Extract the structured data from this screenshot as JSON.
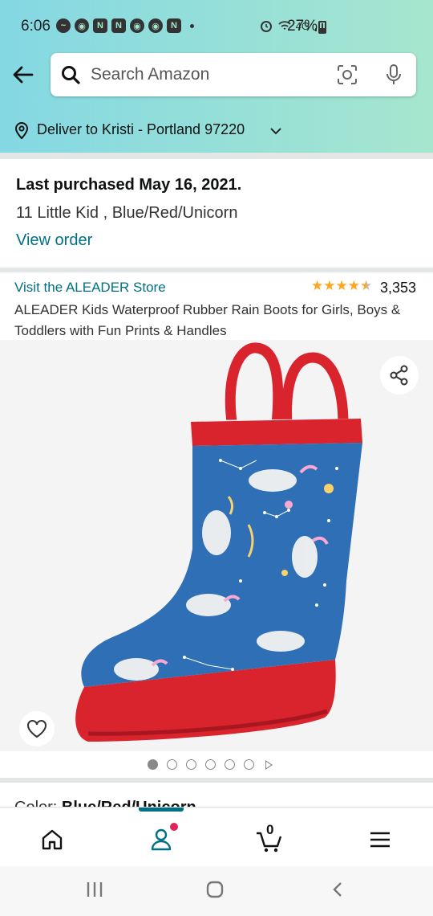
{
  "status_bar": {
    "time": "6:06",
    "network": "4G",
    "battery": "27%"
  },
  "search": {
    "placeholder": "Search Amazon"
  },
  "delivery": {
    "label": "Deliver to Kristi - Portland 97220"
  },
  "purchase_info": {
    "last_purchased": "Last purchased May 16, 2021.",
    "variant": "11 Little Kid , Blue/Red/Unicorn",
    "view_order": "View order"
  },
  "product": {
    "store_link": "Visit the ALEADER Store",
    "rating_stars": 4.5,
    "rating_count": "3,353",
    "title": "ALEADER Kids Waterproof Rubber Rain Boots for Girls, Boys & Toddlers with Fun Prints & Handles",
    "image_count": 6,
    "current_image": 1,
    "color_label": "Color: ",
    "color_value": "Blue/Red/Unicorn"
  },
  "bottom_nav": {
    "cart_count": "0",
    "items": [
      "home-icon",
      "account-icon",
      "cart-icon",
      "menu-icon"
    ]
  },
  "colors": {
    "link": "#007185",
    "star": "#ffa41c",
    "header_gradient_start": "#84d8e3",
    "header_gradient_end": "#a6e6ce",
    "boot_red": "#d9232d",
    "boot_blue": "#2e6fb5"
  }
}
